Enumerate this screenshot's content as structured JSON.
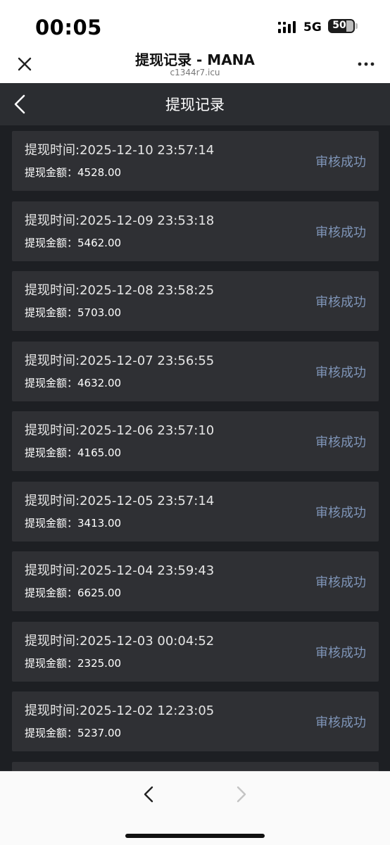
{
  "status_bar": {
    "time": "00:05",
    "network": "5G",
    "battery": "50"
  },
  "browser": {
    "title": "提现记录 - MANA",
    "url": "c1344r7.icu",
    "close_icon": "close-icon",
    "more_icon": "more-icon"
  },
  "app": {
    "title": "提现记录",
    "back_icon": "chevron-left-icon"
  },
  "records": [
    {
      "time_label": "提现时间:2025-12-10 23:57:14",
      "amount_label": "提现金额：4528.00",
      "status": "审核成功"
    },
    {
      "time_label": "提现时间:2025-12-09 23:53:18",
      "amount_label": "提现金额：5462.00",
      "status": "审核成功"
    },
    {
      "time_label": "提现时间:2025-12-08 23:58:25",
      "amount_label": "提现金额：5703.00",
      "status": "审核成功"
    },
    {
      "time_label": "提现时间:2025-12-07 23:56:55",
      "amount_label": "提现金额：4632.00",
      "status": "审核成功"
    },
    {
      "time_label": "提现时间:2025-12-06 23:57:10",
      "amount_label": "提现金额：4165.00",
      "status": "审核成功"
    },
    {
      "time_label": "提现时间:2025-12-05 23:57:14",
      "amount_label": "提现金额：3413.00",
      "status": "审核成功"
    },
    {
      "time_label": "提现时间:2025-12-04 23:59:43",
      "amount_label": "提现金额：6625.00",
      "status": "审核成功"
    },
    {
      "time_label": "提现时间:2025-12-03 00:04:52",
      "amount_label": "提现金额：2325.00",
      "status": "审核成功"
    },
    {
      "time_label": "提现时间:2025-12-02 12:23:05",
      "amount_label": "提现金额：5237.00",
      "status": "审核成功"
    },
    {
      "time_label": "",
      "amount_label": "",
      "status": ""
    }
  ],
  "colors": {
    "app_background": "#1d1f23",
    "card_background": "#2f3034",
    "nav_background": "#2b2d31",
    "status_text": "#7f95b8"
  },
  "bottom_bar": {
    "back_icon": "chevron-left-icon",
    "forward_icon": "chevron-right-icon",
    "forward_enabled": false
  }
}
